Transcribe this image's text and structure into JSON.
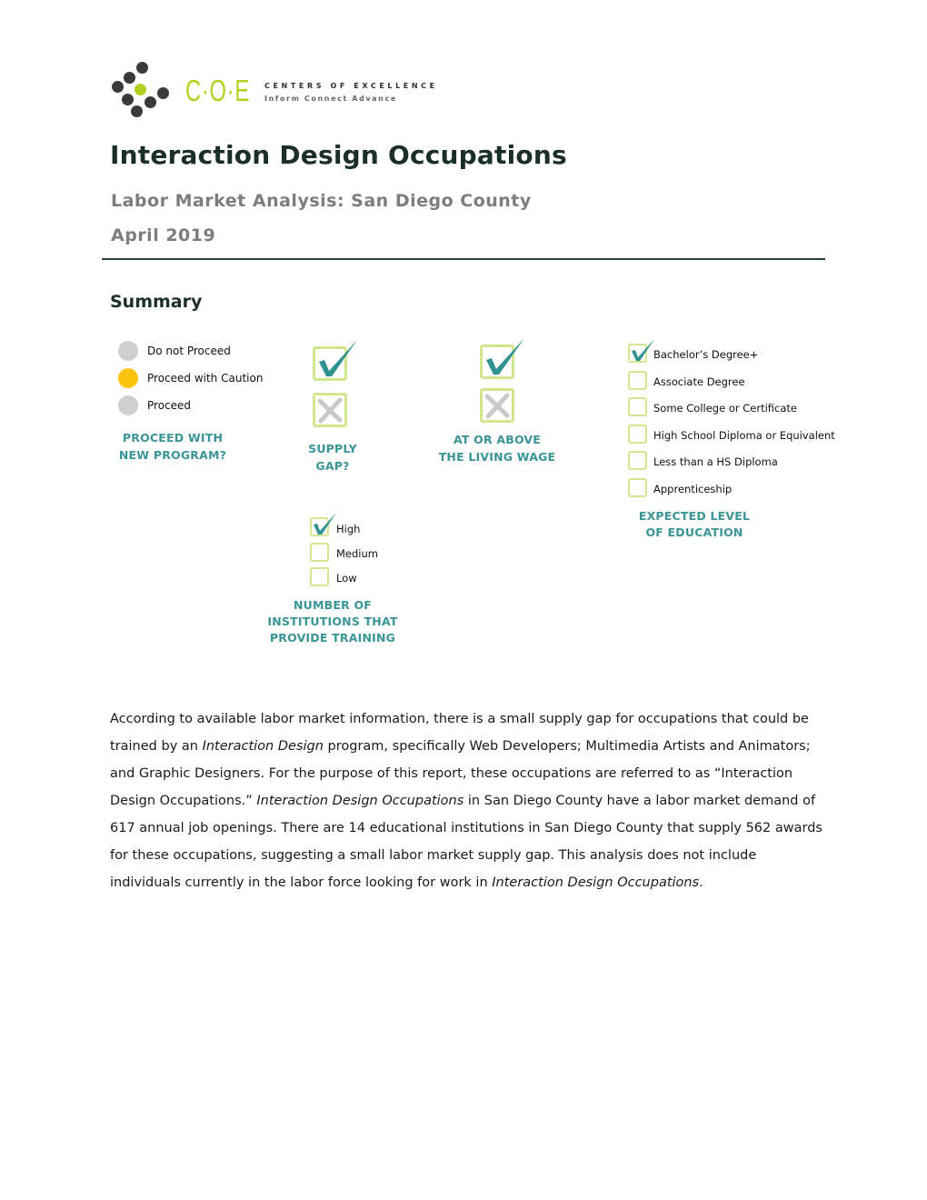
{
  "logo": {
    "mark": "C·O·E",
    "tagline_1": "CENTERS OF EXCELLENCE",
    "tagline_2": "Inform Connect Advance",
    "colors": {
      "green": "#b5cf1e",
      "dark": "#3a3a3a"
    }
  },
  "header": {
    "title": "Interaction Design Occupations",
    "subtitle": "Labor Market Analysis: San Diego County",
    "date": "April 2019"
  },
  "summary": {
    "heading": "Summary",
    "proceed": {
      "legend": [
        {
          "label": "Do not Proceed",
          "color": "#cfcfcf",
          "active": false
        },
        {
          "label": "Proceed with Caution",
          "color": "#fcc30d",
          "active": true
        },
        {
          "label": "Proceed",
          "color": "#cfcfcf",
          "active": false
        }
      ],
      "caption_1": "PROCEED WITH",
      "caption_2": "NEW PROGRAM?"
    },
    "supply_gap": {
      "yes": true,
      "no": false,
      "caption_1": "SUPPLY",
      "caption_2": "GAP?"
    },
    "living_wage": {
      "yes": true,
      "no": false,
      "caption_1": "AT OR ABOVE",
      "caption_2": "THE LIVING WAGE"
    },
    "institutions": {
      "options": [
        {
          "label": "High",
          "checked": true
        },
        {
          "label": "Medium",
          "checked": false
        },
        {
          "label": "Low",
          "checked": false
        }
      ],
      "caption_1": "NUMBER OF",
      "caption_2": "INSTITUTIONS THAT",
      "caption_3": "PROVIDE TRAINING"
    },
    "education": {
      "options": [
        {
          "label": "Bachelor’s Degree+",
          "checked": true
        },
        {
          "label": "Associate Degree",
          "checked": false
        },
        {
          "label": "Some College or Certificate",
          "checked": false
        },
        {
          "label": "High School Diploma or Equivalent",
          "checked": false
        },
        {
          "label": "Less than a HS Diploma",
          "checked": false
        },
        {
          "label": "Apprenticeship",
          "checked": false
        }
      ],
      "caption_1": "EXPECTED LEVEL",
      "caption_2": "OF EDUCATION"
    },
    "colors": {
      "check": "#2f9190",
      "box": "#d2e690",
      "cross": "#c9c9c9",
      "caption": "#3a9596"
    }
  },
  "body": {
    "p1": "According to available labor market information, there is a small supply gap for occupations that could be trained by an ",
    "p1_italic": "Interaction Design",
    "p2": " program, specifically Web Developers; Multimedia Artists and Animators; and Graphic Designers. For the purpose of this report, these occupations are referred to as “Interaction Design Occupations.” ",
    "p2_italic": "Interaction Design Occupations",
    "p3": " in San Diego County have a labor market demand of 617 annual job openings. There are 14 educational institutions in San Diego County that supply 562 awards for these occupations, suggesting a small labor market supply gap. This analysis does not include individuals currently in the labor force looking for work in ",
    "p3_italic": "Interaction Design Occupations",
    "p4": "."
  }
}
